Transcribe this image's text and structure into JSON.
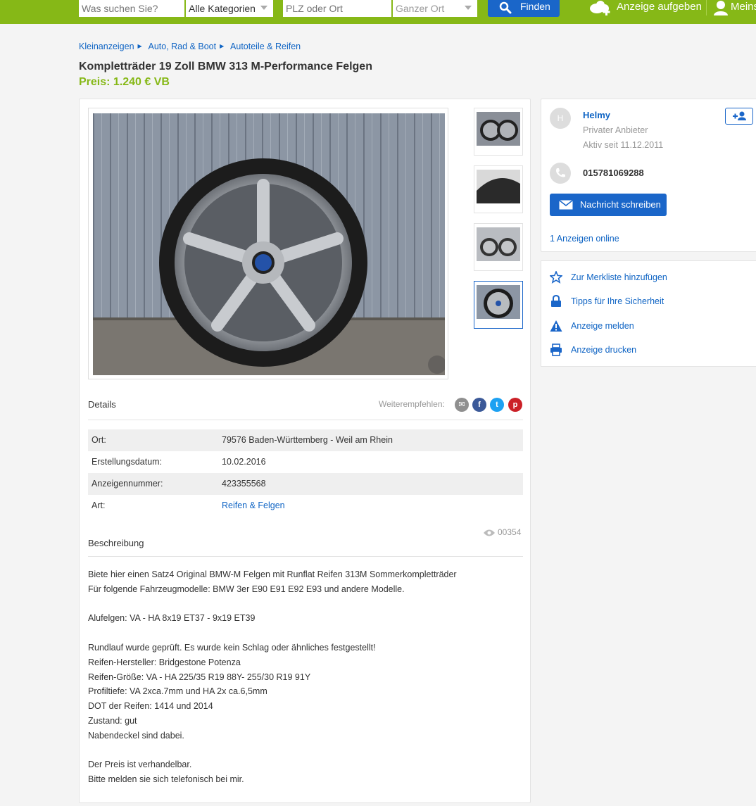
{
  "header": {
    "search_placeholder": "Was suchen Sie?",
    "category_select": "Alle Kategorien",
    "location_placeholder": "PLZ oder Ort",
    "radius_select": "Ganzer Ort",
    "find_label": "Finden",
    "post_ad_label": "Anzeige aufgeben",
    "my_account_label": "Meins"
  },
  "breadcrumb": [
    "Kleinanzeigen",
    "Auto, Rad & Boot",
    "Autoteile & Reifen"
  ],
  "listing": {
    "title": "Kompletträder 19 Zoll BMW 313 M-Performance Felgen",
    "price": "Preis: 1.240 € VB"
  },
  "details": {
    "heading": "Details",
    "share_label": "Weiterempfehlen:",
    "rows": [
      {
        "key": "Ort:",
        "value": "79576 Baden-Württemberg - Weil am Rhein"
      },
      {
        "key": "Erstellungsdatum:",
        "value": "10.02.2016"
      },
      {
        "key": "Anzeigennummer:",
        "value": "423355568"
      },
      {
        "key": "Art:",
        "value": "Reifen & Felgen"
      }
    ],
    "views": "00354"
  },
  "description": {
    "heading": "Beschreibung",
    "lines": [
      "Biete hier einen Satz4 Original BMW-M Felgen mit Runflat Reifen 313M Sommerkompletträder",
      "Für folgende Fahrzeugmodelle: BMW 3er E90 E91 E92 E93 und andere Modelle.",
      "",
      "Alufelgen: VA - HA  8x19 ET37 - 9x19 ET39",
      "",
      "Rundlauf wurde geprüft. Es wurde kein Schlag oder ähnliches festgestellt!",
      "Reifen-Hersteller:  Bridgestone Potenza",
      "Reifen-Größe: VA - HA 225/35 R19 88Y- 255/30 R19 91Y",
      "Profiltiefe: VA  2xca.7mm und  HA  2x ca.6,5mm",
      "DOT der Reifen: 1414 und 2014",
      "Zustand:  gut",
      "Nabendeckel sind dabei.",
      "",
      "Der Preis ist verhandelbar.",
      "Bitte melden sie sich telefonisch bei mir."
    ]
  },
  "seller": {
    "avatar_initial": "H",
    "name": "Helmy",
    "type": "Privater Anbieter",
    "active_since": "Aktiv seit 11.12.2011",
    "phone": "015781069288",
    "message_button": "Nachricht schreiben",
    "ads_online": "1 Anzeigen online"
  },
  "actions": [
    {
      "label": "Zur Merkliste hinzufügen",
      "icon": "star-icon"
    },
    {
      "label": "Tipps für Ihre Sicherheit",
      "icon": "lock-icon"
    },
    {
      "label": "Anzeige melden",
      "icon": "warning-icon"
    },
    {
      "label": "Anzeige drucken",
      "icon": "printer-icon"
    }
  ],
  "colors": {
    "brand_green": "#86b817",
    "link_blue": "#0f64c4",
    "button_blue": "#1a66c9"
  }
}
